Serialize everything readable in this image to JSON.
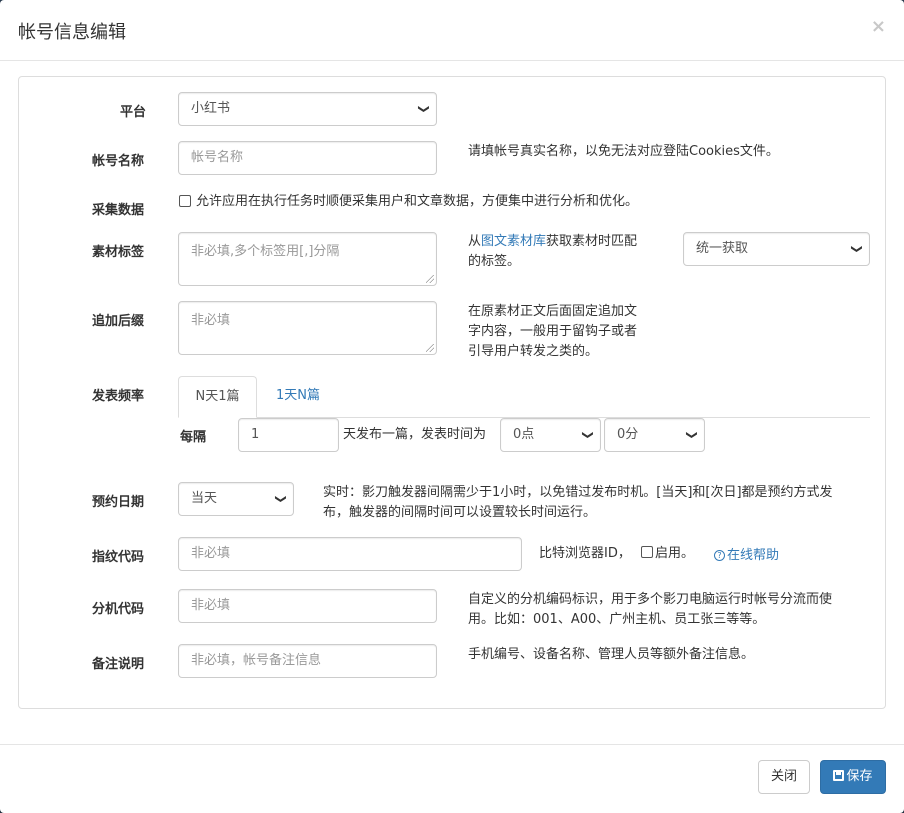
{
  "modal": {
    "title": "帐号信息编辑",
    "close_glyph": "×"
  },
  "platform": {
    "label": "平台",
    "selected": "小红书"
  },
  "account_name": {
    "label": "帐号名称",
    "placeholder": "帐号名称",
    "help": "请填帐号真实名称，以免无法对应登陆Cookies文件。"
  },
  "collect": {
    "label": "采集数据",
    "checked": false,
    "text": "允许应用在执行任务时顺便采集用户和文章数据，方便集中进行分析和优化。"
  },
  "material_tags": {
    "label": "素材标签",
    "placeholder": "非必填,多个标签用[,]分隔",
    "help_prefix": "从",
    "help_link": "图文素材库",
    "help_suffix": "获取素材时匹配",
    "help_line2": "的标签。",
    "select_selected": "统一获取"
  },
  "suffix": {
    "label": "追加后缀",
    "placeholder": "非必填",
    "help_lines": [
      "在原素材正文后面固定追加文",
      "字内容，一般用于留钩子或者",
      "引导用户转发之类的。"
    ]
  },
  "frequency": {
    "label": "发表频率",
    "tabs": [
      "N天1篇",
      "1天N篇"
    ],
    "active_tab": 0,
    "every_label": "每隔",
    "days_value": "1",
    "mid_text": "天发布一篇，发表时间为",
    "hour_selected": "0点",
    "minute_selected": "0分"
  },
  "schedule": {
    "label": "预约日期",
    "selected": "当天",
    "help_line1": "实时：影刀触发器间隔需少于1小时，以免错过发布时机。[当天]和[次日]都是预约方式发",
    "help_line2": "布，触发器的间隔时间可以设置较长时间运行。"
  },
  "fingerprint": {
    "label": "指纹代码",
    "placeholder": "非必填",
    "browser_text": "比特浏览器ID，",
    "enable_checked": false,
    "enable_text": "启用。",
    "help_link": "在线帮助",
    "help_icon": "question-circle-icon"
  },
  "machine_code": {
    "label": "分机代码",
    "placeholder": "非必填",
    "help_line1": "自定义的分机编码标识，用于多个影刀电脑运行时帐号分流而使",
    "help_line2": "用。比如：001、A00、广州主机、员工张三等等。"
  },
  "remark": {
    "label": "备注说明",
    "placeholder": "非必填，帐号备注信息",
    "help": "手机编号、设备名称、管理人员等额外备注信息。"
  },
  "footer": {
    "close_label": "关闭",
    "save_label": "保存"
  },
  "colors": {
    "primary": "#337ab7",
    "link": "#337ab7",
    "border": "#cccccc"
  }
}
